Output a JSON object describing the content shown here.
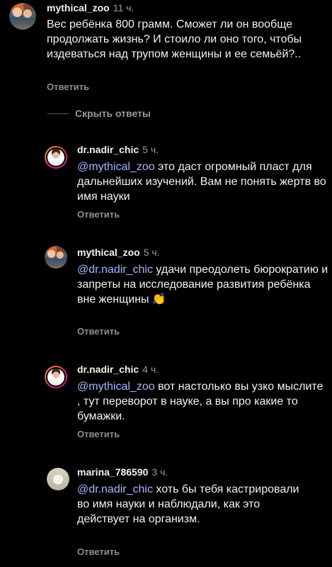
{
  "comments": [
    {
      "username": "mythical_zoo",
      "time": "11 ч.",
      "mention": "",
      "text": "Вес ребёнка 800 грамм. Сможет ли он вообще продолжать жизнь? И стоило ли оно того, чтобы издеваться над трупом женщины и ее семьёй?..",
      "reply_label": "Ответить",
      "avatar_icon": "profile-avatar-icon"
    }
  ],
  "hide_replies_label": "Скрыть ответы",
  "replies": [
    {
      "username": "dr.nadir_chic",
      "time": "5 ч.",
      "mention": "@mythical_zoo",
      "text": " это даст огромный пласт для дальнейших изучений. Вам не понять жертв во имя науки",
      "reply_label": "Ответить"
    },
    {
      "username": "mythical_zoo",
      "time": "5 ч.",
      "mention": "@dr.nadir_chic",
      "text": " удачи преодолеть бюрократию и запреты на исследование развития ребёнка вне женщины",
      "emoji": "👏",
      "reply_label": "Ответить"
    },
    {
      "username": "dr.nadir_chic",
      "time": "4 ч.",
      "mention": "@mythical_zoo",
      "text": " вот настолько вы узко мыслите , тут переворот в науке, а вы про какие то бумажки.",
      "reply_label": "Ответить"
    },
    {
      "username": "marina_786590",
      "time": "3 ч.",
      "mention": "@dr.nadir_chic",
      "text": " хоть бы тебя кастрировали во имя науки и наблюдали, как это действует на организм.",
      "reply_label": "Ответить"
    }
  ],
  "colors": {
    "background": "#000000",
    "text": "#f2f2f2",
    "mention": "#a9b4ff",
    "muted": "#8e8e8e"
  }
}
